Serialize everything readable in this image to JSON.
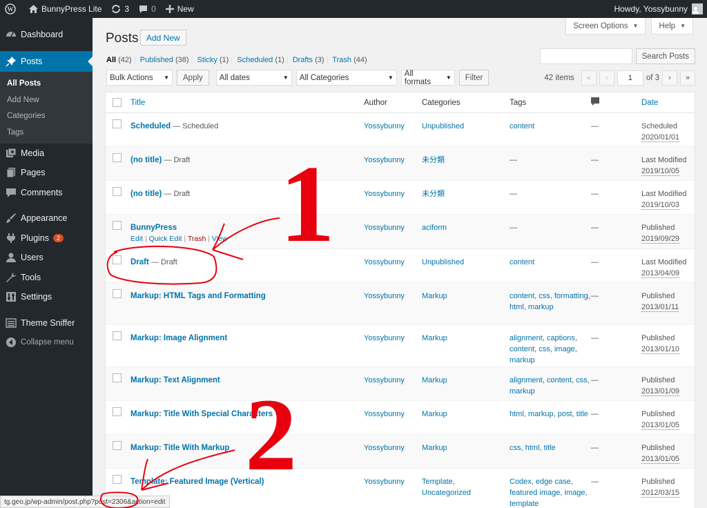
{
  "adminbar": {
    "site_name": "BunnyPress Lite",
    "updates_count": "3",
    "comments_count": "0",
    "new_label": "New",
    "howdy": "Howdy, Yossybunny",
    "icons": [
      "wordpress-icon",
      "home-icon",
      "updates-icon",
      "comment-icon",
      "plus-icon",
      "avatar"
    ]
  },
  "menu": {
    "dashboard": "Dashboard",
    "posts": "Posts",
    "submenu": [
      "All Posts",
      "Add New",
      "Categories",
      "Tags"
    ],
    "media": "Media",
    "pages": "Pages",
    "comments": "Comments",
    "appearance": "Appearance",
    "plugins": "Plugins",
    "plugins_badge": "2",
    "users": "Users",
    "tools": "Tools",
    "settings": "Settings",
    "theme_sniffer": "Theme Sniffer",
    "collapse": "Collapse menu"
  },
  "header": {
    "screen_options": "Screen Options",
    "help": "Help",
    "title": "Posts",
    "add_new": "Add New"
  },
  "views": [
    {
      "label": "All",
      "count": "(42)"
    },
    {
      "label": "Published",
      "count": "(38)"
    },
    {
      "label": "Sticky",
      "count": "(1)"
    },
    {
      "label": "Scheduled",
      "count": "(1)"
    },
    {
      "label": "Drafts",
      "count": "(3)"
    },
    {
      "label": "Trash",
      "count": "(44)"
    }
  ],
  "search": {
    "button": "Search Posts"
  },
  "tablenav": {
    "bulk_actions": "Bulk Actions",
    "apply": "Apply",
    "all_dates": "All dates",
    "all_categories": "All Categories",
    "all_formats": "All formats",
    "filter": "Filter",
    "items": "42 items",
    "first": "«",
    "prev": "‹",
    "current_page": "1",
    "of_pages": "of 3",
    "next": "›",
    "last": "»"
  },
  "columns": {
    "title": "Title",
    "author": "Author",
    "categories": "Categories",
    "tags": "Tags",
    "date": "Date"
  },
  "row_actions": {
    "edit": "Edit",
    "quick_edit": "Quick Edit",
    "trash": "Trash",
    "view": "View"
  },
  "rows": [
    {
      "title": "Scheduled",
      "state": " — Scheduled",
      "author": "Yossybunny",
      "categories": [
        "Unpublished"
      ],
      "tags": [
        "content"
      ],
      "comments": "—",
      "date_status": "Scheduled",
      "date": "2020/01/01"
    },
    {
      "title": "(no title)",
      "state": " — Draft",
      "author": "Yossybunny",
      "categories": [
        "未分類"
      ],
      "tags": [],
      "tags_text": "—",
      "comments": "—",
      "date_status": "Last Modified",
      "date": "2019/10/05"
    },
    {
      "title": "(no title)",
      "state": " — Draft",
      "author": "Yossybunny",
      "categories": [
        "未分類"
      ],
      "tags": [],
      "tags_text": "—",
      "comments": "—",
      "date_status": "Last Modified",
      "date": "2019/10/03"
    },
    {
      "title": "BunnyPress",
      "state": "",
      "author": "Yossybunny",
      "categories": [
        "aciform"
      ],
      "tags": [],
      "tags_text": "—",
      "comments": "—",
      "date_status": "Published",
      "date": "2019/09/29",
      "show_actions": true
    },
    {
      "title": "Draft",
      "state": " — Draft",
      "author": "Yossybunny",
      "categories": [
        "Unpublished"
      ],
      "tags": [
        "content"
      ],
      "comments": "—",
      "date_status": "Last Modified",
      "date": "2013/04/09"
    },
    {
      "title": "Markup: HTML Tags and Formatting",
      "state": "",
      "author": "Yossybunny",
      "categories": [
        "Markup"
      ],
      "tags": [
        "content",
        "css",
        "formatting",
        "html",
        "markup"
      ],
      "comments": "—",
      "date_status": "Published",
      "date": "2013/01/11"
    },
    {
      "title": "Markup: Image Alignment",
      "state": "",
      "author": "Yossybunny",
      "categories": [
        "Markup"
      ],
      "tags": [
        "alignment",
        "captions",
        "content",
        "css",
        "image",
        "markup"
      ],
      "comments": "—",
      "date_status": "Published",
      "date": "2013/01/10"
    },
    {
      "title": "Markup: Text Alignment",
      "state": "",
      "author": "Yossybunny",
      "categories": [
        "Markup"
      ],
      "tags": [
        "alignment",
        "content",
        "css",
        "markup"
      ],
      "comments": "—",
      "date_status": "Published",
      "date": "2013/01/09"
    },
    {
      "title": "Markup: Title With Special Characters",
      "state": "",
      "author": "Yossybunny",
      "categories": [
        "Markup"
      ],
      "tags": [
        "html",
        "markup",
        "post",
        "title"
      ],
      "comments": "—",
      "date_status": "Published",
      "date": "2013/01/05"
    },
    {
      "title": "Markup: Title With Markup",
      "state": "",
      "author": "Yossybunny",
      "categories": [
        "Markup"
      ],
      "tags": [
        "css",
        "html",
        "title"
      ],
      "comments": "—",
      "date_status": "Published",
      "date": "2013/01/05"
    },
    {
      "title": "Template: Featured Image (Vertical)",
      "state": "",
      "author": "Yossybunny",
      "categories": [
        "Template",
        "Uncategorized"
      ],
      "tags": [
        "Codex",
        "edge case",
        "featured image",
        "image",
        "template"
      ],
      "comments": "—",
      "date_status": "Published",
      "date": "2012/03/15"
    }
  ],
  "statusbar": {
    "url": "tg.geo.jp/wp-admin/post.php?post=2306&action=edit"
  },
  "annotations": {
    "one": "1",
    "two": "2",
    "color": "#e8000f"
  },
  "colors": {
    "adminbar": "#23282d",
    "accent": "#0073aa",
    "badge": "#d54e21",
    "trash": "#a00000"
  }
}
